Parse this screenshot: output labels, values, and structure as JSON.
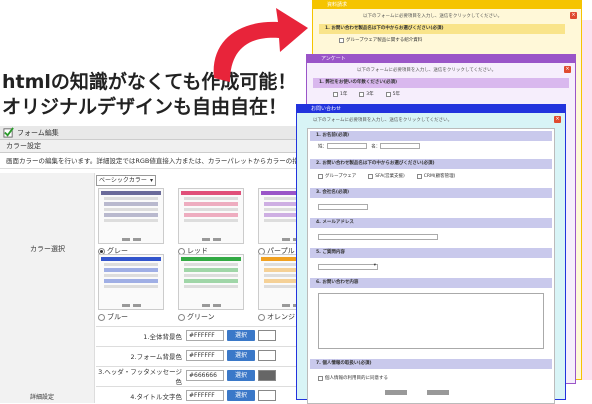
{
  "headline": {
    "line1": "htmlの知識がなくても作成可能！",
    "line2": "オリジナルデザインも自由自在！"
  },
  "editor": {
    "title": "フォーム編集",
    "section": "カラー設定",
    "description": "画面カラーの編集を行います。詳細設定ではRGB値直接入力または、カラーパレットからカラーの指定",
    "color_select_label": "カラー選択",
    "preset": "ベーシックカラー",
    "swatches": [
      {
        "label": "グレー",
        "color": "#6b6b9a",
        "selected": true
      },
      {
        "label": "レッド",
        "color": "#e0507a",
        "selected": false
      },
      {
        "label": "パープル",
        "color": "#9a55c8",
        "selected": false
      },
      {
        "label": "ブルー",
        "color": "#3355cc",
        "selected": false
      },
      {
        "label": "グリーン",
        "color": "#33aa44",
        "selected": false
      },
      {
        "label": "オレンジ",
        "color": "#f0a020",
        "selected": false
      }
    ],
    "settings": [
      {
        "label": "1.全体背景色",
        "value": "#FFFFFF",
        "button": "選択",
        "swatch": "#ffffff"
      },
      {
        "label": "2.フォーム背景色",
        "value": "#FFFFFF",
        "button": "選択",
        "swatch": "#ffffff"
      },
      {
        "label": "3.ヘッダ・フッタメッセージ色",
        "value": "#666666",
        "button": "選択",
        "swatch": "#666666"
      },
      {
        "label": "4.タイトル文字色",
        "value": "#FFFFFF",
        "button": "選択",
        "swatch": "#ffffff"
      }
    ],
    "side_label": "詳細設定"
  },
  "cards": {
    "yellow": {
      "title": "資料請求",
      "intro": "以下のフォームに必要項目を入力し、送信をクリックしてください。",
      "q1": "1. お問い合わせ製品名は下の中からお選びください(必須)",
      "q1_opt": "グループウェア製品に関する紹介資料",
      "color": "#f5c400"
    },
    "purple": {
      "title": "アンケート",
      "intro": "以下のフォームに必要項目を入力し、送信をクリックしてください。",
      "q1": "1. 弊社をお使いの年数ください(必須)",
      "opts": [
        "1年",
        "3年",
        "5年"
      ],
      "color": "#9a55c8"
    },
    "blue": {
      "title": "お問い合わせ",
      "intro": "以下のフォームに必要項目を入力し、送信をクリックしてください。",
      "q1": "1. お名前(必須)",
      "q1_a": "姓：",
      "q1_b": "名：",
      "q2": "2. お問い合わせ製品名は下の中からお選びください(必須)",
      "q2_opts": [
        "グループウェア",
        "SFA(営業支援)",
        "CRM(顧客管理)"
      ],
      "q3": "3. 会社名(必須)",
      "q4": "4. メールアドレス",
      "q5": "5. ご質問内容",
      "q6": "6. お問い合わせ内容",
      "q7": "7. 個人情報の取扱い(必須)",
      "q7_opt": "個人情報の利用目的に同意する",
      "color": "#2233dd"
    },
    "required_mark": "(必須)"
  },
  "colors": {
    "arrow": "#e8243a",
    "yellow_card_bg": "#fff8d8",
    "purple_card_bg": "#f6eefc",
    "blue_card_bg": "#d8f4f6",
    "pink_strip": "#fbe4f0"
  }
}
